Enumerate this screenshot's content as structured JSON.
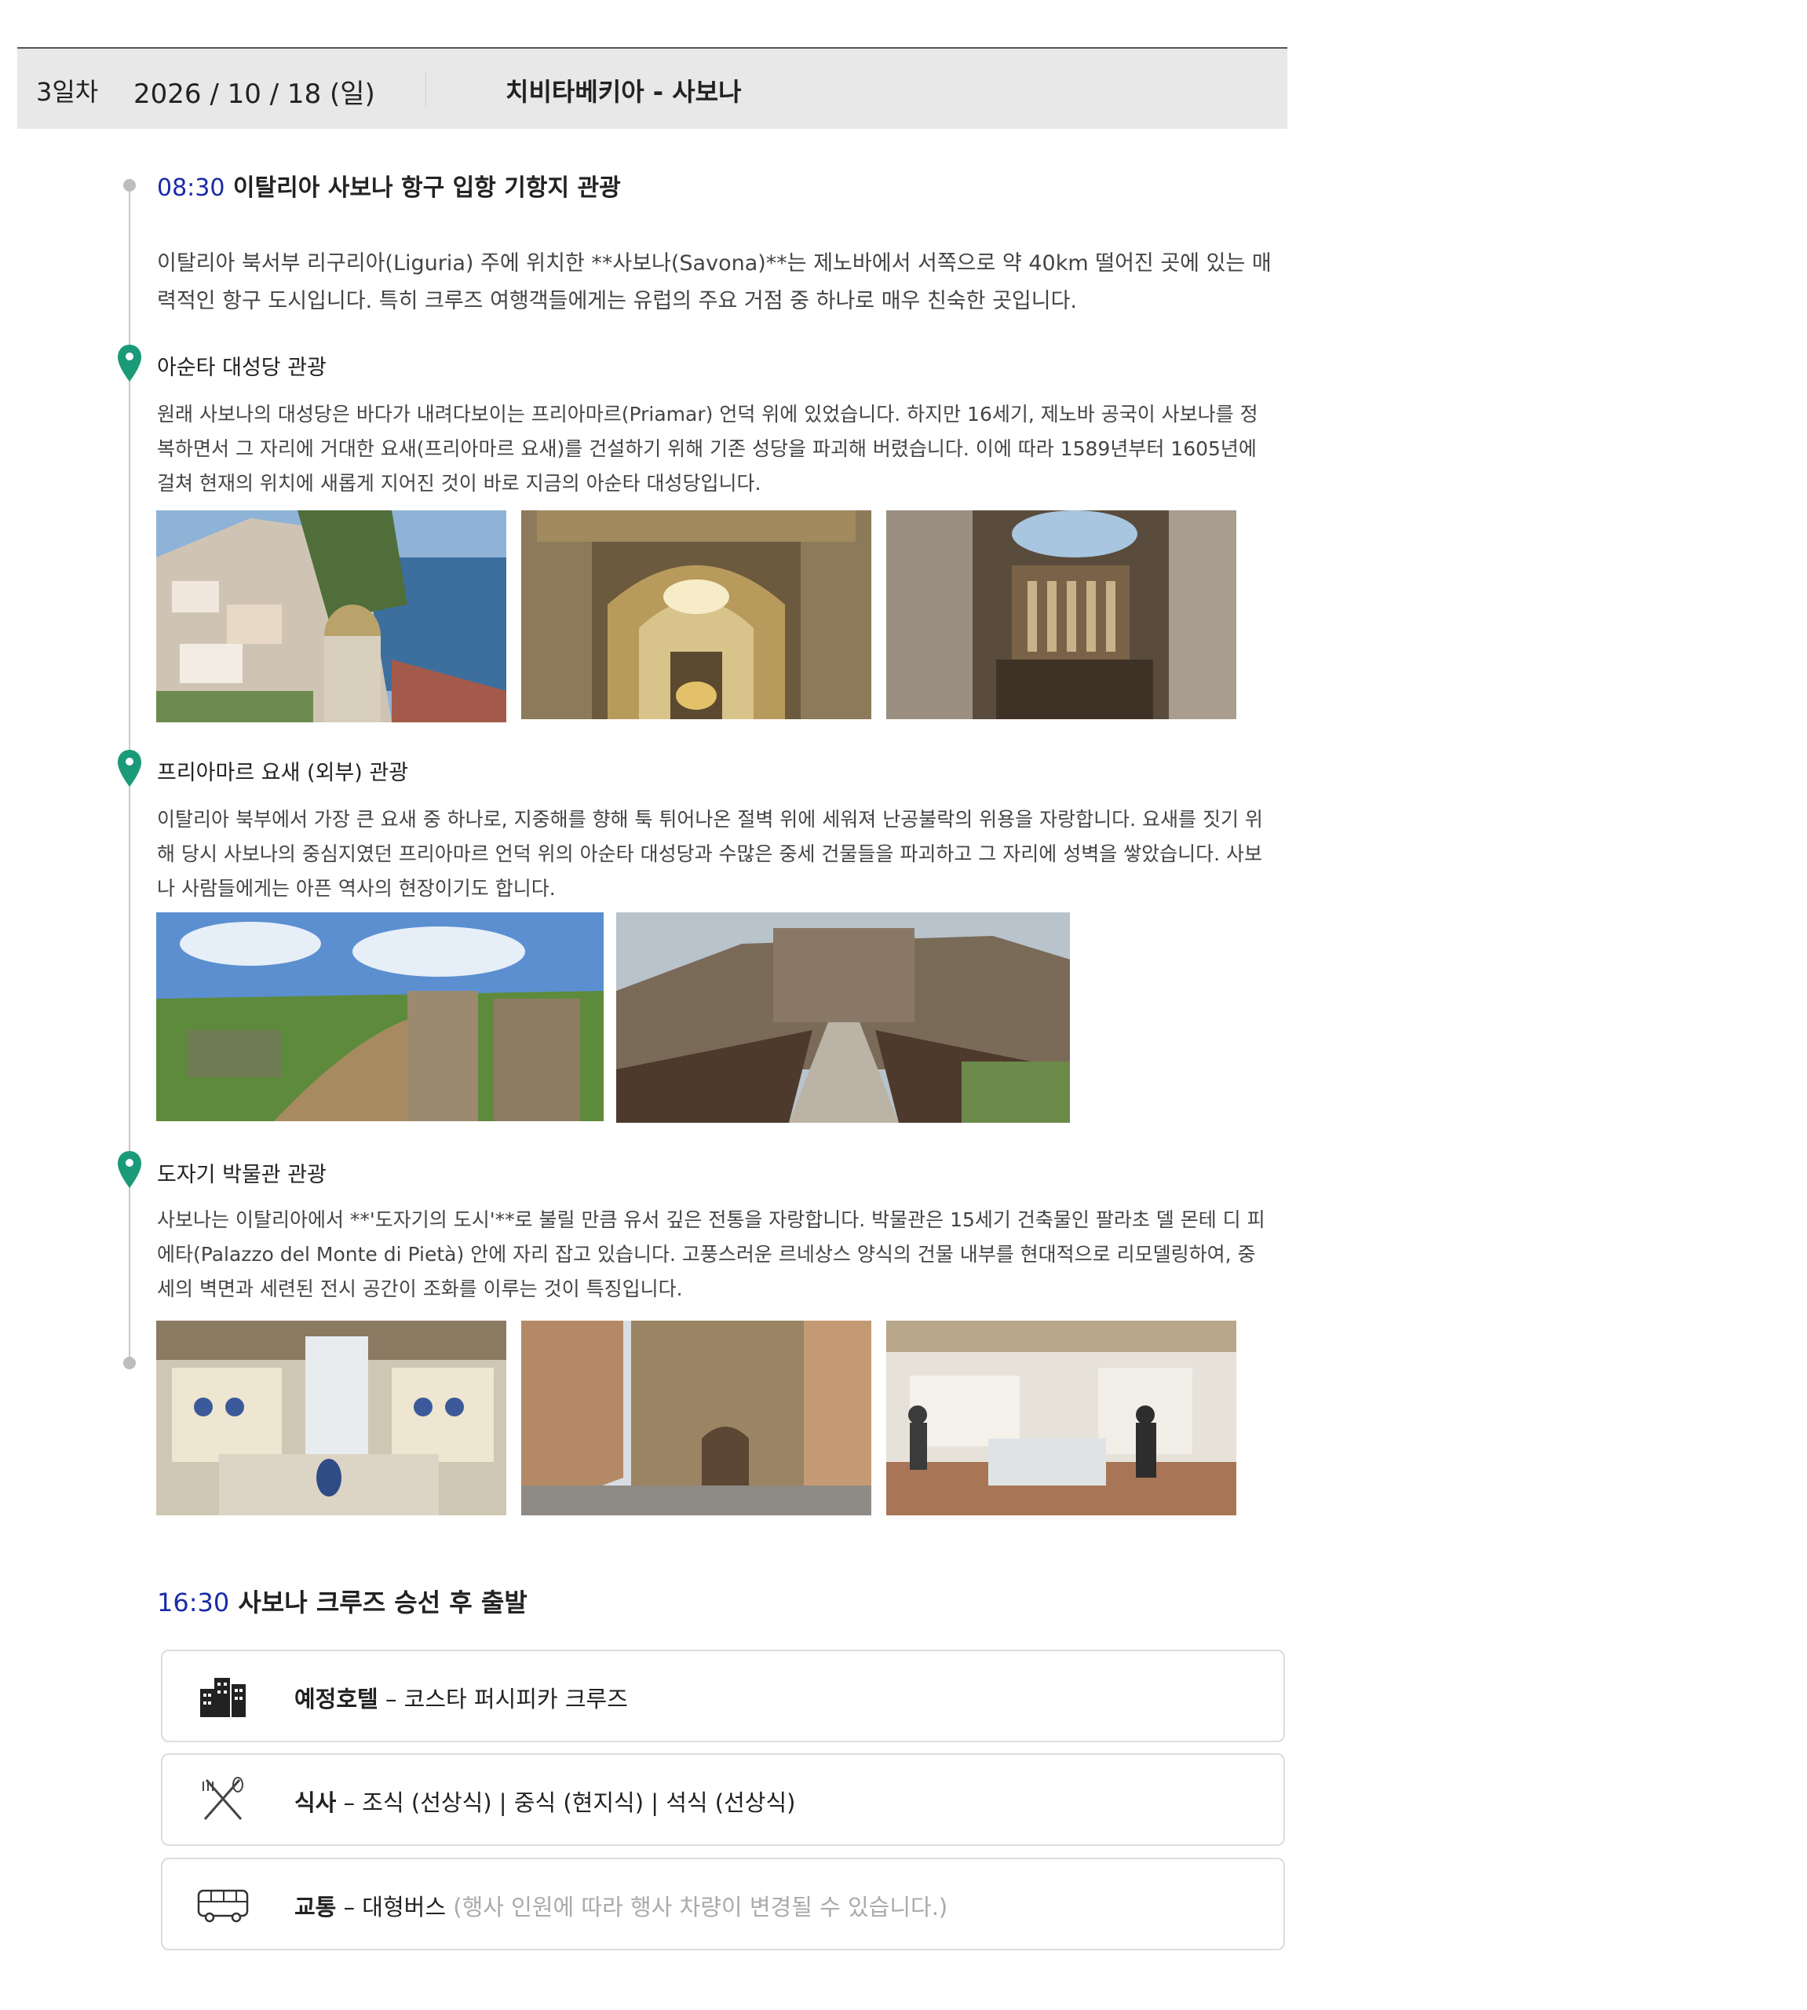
{
  "header": {
    "day": "3일차",
    "date": "2026 / 10 / 18 (일)",
    "route": "치비타베키아 - 사보나"
  },
  "arrival": {
    "time": "08:30",
    "title": "이탈리아 사보나 항구 입항 기항지 관광",
    "description": "이탈리아 북서부 리구리아(Liguria) 주에 위치한 **사보나(Savona)**는 제노바에서 서쪽으로 약 40km 떨어진 곳에 있는 매력적인 항구 도시입니다. 특히 크루즈 여행객들에게는 유럽의 주요 거점 중 하나로 매우 친숙한 곳입니다."
  },
  "spots": [
    {
      "title": "아순타 대성당 관광",
      "description": "원래 사보나의 대성당은 바다가 내려다보이는 프리아마르(Priamar) 언덕 위에 있었습니다. 하지만 16세기, 제노바 공국이 사보나를 정복하면서 그 자리에 거대한 요새(프리아마르 요새)를 건설하기 위해 기존 성당을 파괴해 버렸습니다. 이에 따라 1589년부터 1605년에 걸쳐 현재의 위치에 새롭게 지어진 것이 바로 지금의 아순타 대성당입니다.",
      "photos": [
        "hillside-town-photo",
        "cathedral-nave-photo",
        "cathedral-altar-photo"
      ]
    },
    {
      "title": "프리아마르 요새 (외부) 관광",
      "description": "이탈리아 북부에서 가장 큰 요새 중 하나로, 지중해를 향해 툭 튀어나온 절벽 위에 세워져 난공불락의 위용을 자랑합니다. 요새를 짓기 위해 당시 사보나의 중심지였던 프리아마르 언덕 위의 아순타 대성당과 수많은 중세 건물들을 파괴하고 그 자리에 성벽을 쌓았습니다. 사보나 사람들에게는 아픈 역사의 현장이기도 합니다.",
      "photos": [
        "fortress-ruins-photo",
        "fortress-bridge-photo"
      ]
    },
    {
      "title": "도자기 박물관 관광",
      "description": "사보나는 이탈리아에서 **'도자기의 도시'**로 불릴 만큼 유서 깊은 전통을 자랑합니다. 박물관은 15세기 건축물인 팔라초 델 몬테 디 피에타(Palazzo del Monte di Pietà) 안에 자리 잡고 있습니다. 고풍스러운 르네상스 양식의 건물 내부를 현대적으로 리모델링하여, 중세의 벽면과 세련된 전시 공간이 조화를 이루는 것이 특징입니다.",
      "photos": [
        "museum-gallery-photo",
        "museum-street-photo",
        "museum-visitors-photo"
      ]
    }
  ],
  "departure": {
    "time": "16:30",
    "title": "사보나 크루즈 승선 후 출발"
  },
  "info": [
    {
      "icon": "hotel-icon",
      "label": "예정호텔",
      "value": "– 코스타 퍼시피카 크루즈",
      "note": ""
    },
    {
      "icon": "meal-icon",
      "label": "식사",
      "value": "– 조식 (선상식) | 중식 (현지식) | 석식 (선상식)",
      "note": ""
    },
    {
      "icon": "bus-icon",
      "label": "교통",
      "value": "– 대형버스",
      "note": "(행사 인원에 따라 행사 차량이 변경될 수 있습니다.)"
    }
  ],
  "colors": {
    "time_accent": "#1a2aa8",
    "pin": "#1a9a78",
    "header_bg": "#e8e8e8"
  }
}
